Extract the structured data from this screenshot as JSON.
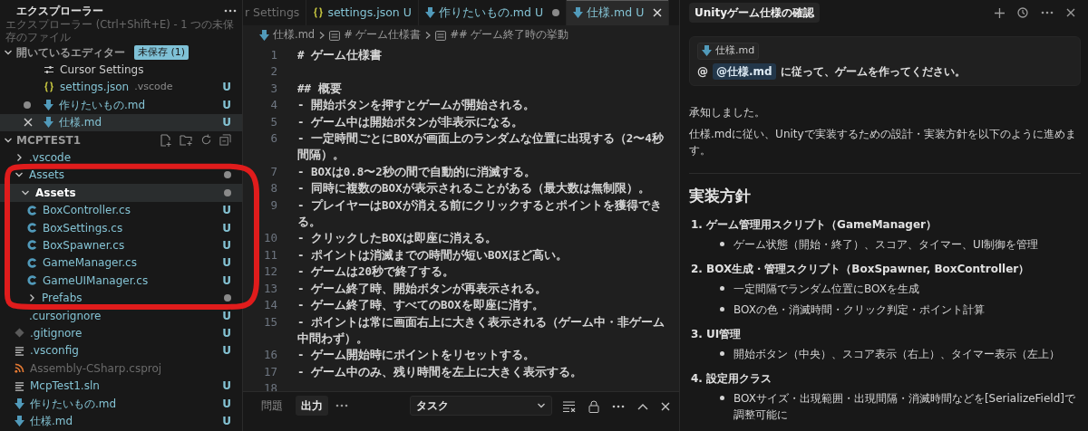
{
  "explorer": {
    "title": "エクスプローラー",
    "tooltip": "エクスプローラー (Ctrl+Shift+E) - 1 つの未保存のファイル",
    "open_editors": {
      "label": "開いているエディター",
      "badge": "未保存 (1)",
      "expanded": true,
      "items": [
        {
          "kind": "settings",
          "name": "Cursor Settings",
          "dirty": false,
          "selected": false
        },
        {
          "kind": "json",
          "name": "settings.json",
          "detail": ".vscode",
          "status": "U",
          "dirty": false,
          "selected": false
        },
        {
          "kind": "markdown",
          "name": "作りたいもの.md",
          "status": "U",
          "dirty": true,
          "selected": false
        },
        {
          "kind": "markdown",
          "name": "仕様.md",
          "status": "U",
          "dirty": false,
          "selected": true
        }
      ]
    },
    "project": {
      "label": "MCPTEST1",
      "expanded": true,
      "tree": [
        {
          "kind": "folder",
          "name": ".vscode",
          "expanded": false,
          "modified": false,
          "selected": false
        },
        {
          "kind": "folder",
          "name": "Assets",
          "expanded": true,
          "modified": true,
          "selected": false,
          "children": [
            {
              "kind": "folder",
              "name": "Assets",
              "expanded": true,
              "modified": true,
              "selected": true,
              "children": [
                {
                  "kind": "csharp",
                  "name": "BoxController.cs",
                  "status": "U",
                  "dimmed": false,
                  "selected": false
                },
                {
                  "kind": "csharp",
                  "name": "BoxSettings.cs",
                  "status": "U",
                  "dimmed": false,
                  "selected": false
                },
                {
                  "kind": "csharp",
                  "name": "BoxSpawner.cs",
                  "status": "U",
                  "dimmed": false,
                  "selected": false
                },
                {
                  "kind": "csharp",
                  "name": "GameManager.cs",
                  "status": "U",
                  "dimmed": false,
                  "selected": false
                },
                {
                  "kind": "csharp",
                  "name": "GameUIManager.cs",
                  "status": "U",
                  "dimmed": false,
                  "selected": false
                },
                {
                  "kind": "folder",
                  "name": "Prefabs",
                  "expanded": false,
                  "modified": true,
                  "selected": false
                }
              ]
            }
          ]
        },
        {
          "kind": "plain",
          "name": ".cursorignore",
          "status": "U",
          "dimmed": false,
          "selected": false
        },
        {
          "kind": "gitignore",
          "name": ".gitignore",
          "status": "U",
          "dimmed": false,
          "selected": false
        },
        {
          "kind": "text",
          "name": ".vsconfig",
          "status": "U",
          "dimmed": false,
          "selected": false
        },
        {
          "kind": "rss",
          "name": "Assembly-CSharp.csproj",
          "dimmed": true,
          "selected": false
        },
        {
          "kind": "text",
          "name": "McpTest1.sln",
          "status": "U",
          "dimmed": false,
          "selected": false
        },
        {
          "kind": "markdown",
          "name": "作りたいもの.md",
          "status": "U",
          "dimmed": false,
          "selected": false
        },
        {
          "kind": "markdown",
          "name": "仕様.md",
          "status": "U",
          "dimmed": false,
          "selected": false
        }
      ]
    }
  },
  "editor": {
    "tabs": [
      {
        "label": "r Settings",
        "selected": false,
        "dirty": false
      },
      {
        "kind": "json",
        "label": "settings.json",
        "status": "U",
        "selected": false,
        "dirty": false
      },
      {
        "kind": "markdown",
        "label": "作りたいもの.md",
        "status": "U",
        "selected": false,
        "dirty": true
      },
      {
        "kind": "markdown",
        "label": "仕様.md",
        "status": "U",
        "selected": true,
        "dirty": false
      }
    ],
    "breadcrumb": [
      {
        "kind": "file",
        "text": "仕様.md"
      },
      {
        "kind": "heading",
        "text": "# ゲーム仕様書"
      },
      {
        "kind": "heading",
        "text": "## ゲーム終了時の挙動"
      }
    ],
    "lines": [
      {
        "number": "1",
        "text": "# ゲーム仕様書"
      },
      {
        "number": "2"
      },
      {
        "number": "3",
        "text": "## 概要"
      },
      {
        "number": "4",
        "text": "- 開始ボタンを押すとゲームが開始される。"
      },
      {
        "number": "5",
        "text": "- ゲーム中は開始ボタンが非表示になる。"
      },
      {
        "number": "6",
        "text": "- 一定時間ごとにBOXが画面上のランダムな位置に出現する（2〜4秒間隔）。"
      },
      {
        "number": "7",
        "text": "- BOXは0.8〜2秒の間で自動的に消滅する。"
      },
      {
        "number": "8",
        "text": "- 同時に複数のBOXが表示されることがある（最大数は無制限）。"
      },
      {
        "number": "9",
        "text": "- プレイヤーはBOXが消える前にクリックするとポイントを獲得できる。"
      },
      {
        "number": "10",
        "text": "- クリックしたBOXは即座に消える。"
      },
      {
        "number": "11",
        "text": "- ポイントは消滅までの時間が短いBOXほど高い。"
      },
      {
        "number": "12",
        "text": "- ゲームは20秒で終了する。"
      },
      {
        "number": "13",
        "text": "- ゲーム終了時、開始ボタンが再表示される。"
      },
      {
        "number": "14",
        "text": "- ゲーム終了時、すべてのBOXを即座に消す。"
      },
      {
        "number": "15",
        "text": "- ポイントは常に画面右上に大きく表示される（ゲーム中・非ゲーム中問わず）。"
      },
      {
        "number": "16",
        "text": "- ゲーム開始時にポイントをリセットする。"
      },
      {
        "number": "17",
        "text": "- ゲーム中のみ、残り時間を左上に大きく表示する。"
      },
      {
        "number": "18"
      }
    ]
  },
  "panel": {
    "tabs": [
      {
        "label": "問題",
        "selected": false
      },
      {
        "label": "出力",
        "selected": true
      }
    ],
    "task_select": "タスク"
  },
  "chat": {
    "title": "Unityゲーム仕様の確認",
    "context_chip": "仕様.md",
    "message": {
      "prefix": "@",
      "mention": "@仕様.md",
      "text": "に従って、ゲームを作ってください。"
    },
    "response": [
      "承知しました。",
      "仕様.mdに従い、Unityで実装するための設計・実装方針を以下のように進めます。"
    ],
    "heading": "実装方針",
    "steps": [
      {
        "number": "1.",
        "title": "ゲーム管理用スクリプト（GameManager）",
        "bullets": [
          "ゲーム状態（開始・終了）、スコア、タイマー、UI制御を管理"
        ]
      },
      {
        "number": "2.",
        "title": "BOX生成・管理スクリプト（BoxSpawner, BoxController）",
        "bullets": [
          "一定間隔でランダム位置にBOXを生成",
          "BOXの色・消滅時間・クリック判定・ポイント計算"
        ]
      },
      {
        "number": "3.",
        "title": "UI管理",
        "bullets": [
          "開始ボタン（中央）、スコア表示（右上）、タイマー表示（左上）"
        ]
      },
      {
        "number": "4.",
        "title": "設定用クラス",
        "bullets": [
          "BOXサイズ・出現範囲・出現間隔・消滅時間などを[SerializeField]で調整可能に"
        ]
      }
    ]
  },
  "annotations": [
    {
      "kind": "loop"
    }
  ]
}
